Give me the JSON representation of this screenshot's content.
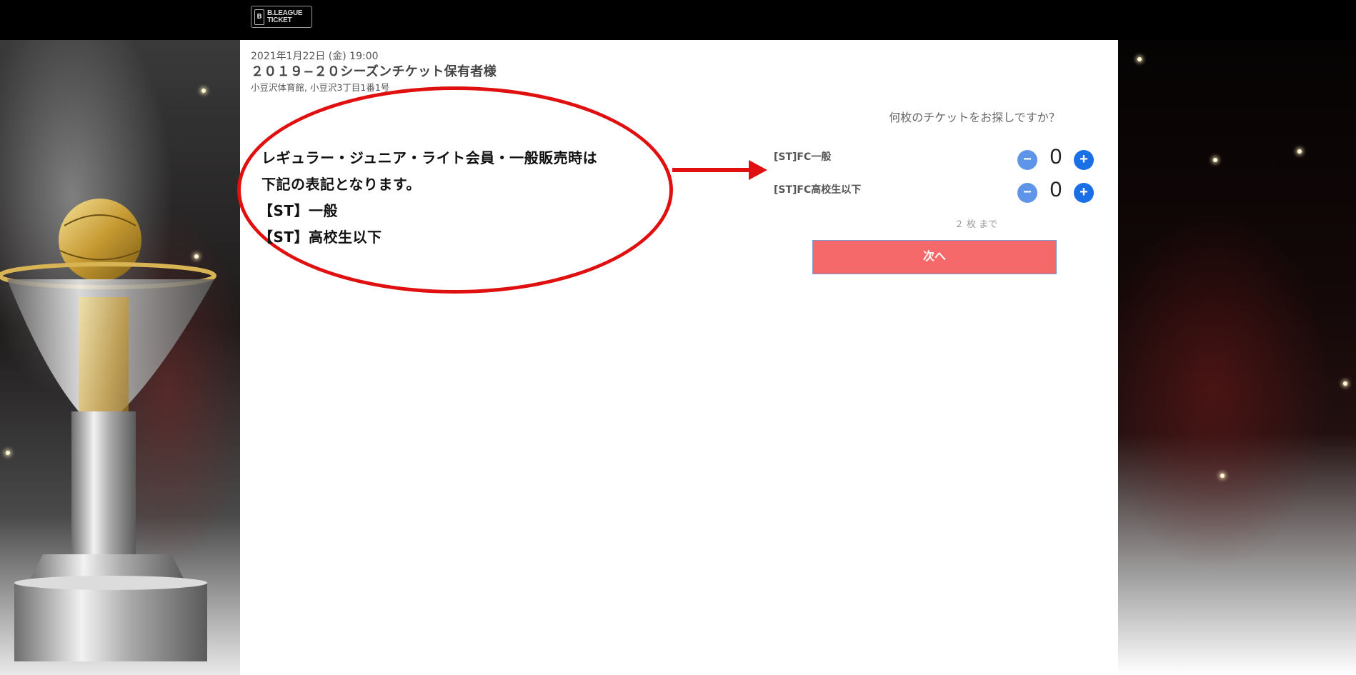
{
  "header": {
    "logo_line1": "B.LEAGUE",
    "logo_line2": "TICKET",
    "logo_mark": "B"
  },
  "event": {
    "date_time": "2021年1月22日 (金) 19:00",
    "title": "２０１９−２０シーズンチケット保有者様",
    "venue": "小豆沢体育館, 小豆沢3丁目1番1号"
  },
  "annotation": {
    "lines": [
      "レギュラー・ジュニア・ライト会員・一般販売時は",
      "下記の表記となります。",
      "【ST】一般",
      "【ST】高校生以下"
    ],
    "color": "#e01010"
  },
  "ticket_selector": {
    "question": "何枚のチケットをお探しですか？",
    "tickets": [
      {
        "name": "[ST]FC一般",
        "quantity": "0",
        "minus_icon": "minus-icon",
        "plus_icon": "plus-icon"
      },
      {
        "name": "[ST]FC高校生以下",
        "quantity": "0",
        "minus_icon": "minus-icon",
        "plus_icon": "plus-icon"
      }
    ],
    "limit_text": "２ 枚 まで",
    "next_label": "次へ"
  },
  "colors": {
    "accent_button": "#f5696b",
    "minus_button": "#5f95e9",
    "plus_button": "#1a6ee6",
    "header_bg": "#000000"
  }
}
